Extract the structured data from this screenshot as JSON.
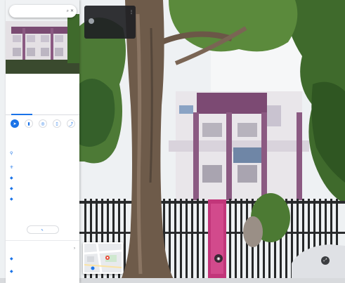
{
  "search": {
    "value": "",
    "placeholder": ""
  },
  "icons": {
    "search": "search-icon",
    "close": "close-icon",
    "directions": "directions-icon",
    "save": "bookmark-icon",
    "nearby": "nearby-icon",
    "send": "send-to-phone-icon",
    "share": "share-icon",
    "location_pin": "location-pin-icon",
    "plus_code": "plus-code-icon",
    "label": "label-icon",
    "chevron": "chevron-icon",
    "edit": "pencil-icon",
    "more": "more-vert-icon",
    "zoom": "zoom-icon",
    "expand": "expand-icon"
  },
  "place": {
    "title": "",
    "category": "",
    "meta": ""
  },
  "tabs": [
    {
      "label": "",
      "active": true
    },
    {
      "label": "",
      "active": false
    }
  ],
  "actions": [
    {
      "label": "",
      "icon": "directions-icon",
      "style": "primary"
    },
    {
      "label": "",
      "icon": "bookmark-icon",
      "style": "outline"
    },
    {
      "label": "",
      "icon": "nearby-icon",
      "style": "outline"
    },
    {
      "label": "",
      "icon": "send-to-phone-icon",
      "style": "outline"
    },
    {
      "label": "",
      "icon": "share-icon",
      "style": "outline"
    }
  ],
  "info": [
    {
      "icon": "location-pin-icon",
      "text": "",
      "text2": ""
    },
    {
      "icon": "plus-code-icon",
      "text": ""
    },
    {
      "icon": "label-icon",
      "text": ""
    },
    {
      "icon": "label-icon",
      "text": ""
    },
    {
      "icon": "label-icon",
      "text": ""
    }
  ],
  "suggest_edit": {
    "label": ""
  },
  "section": {
    "heading": ""
  },
  "bottom_items": [
    {
      "text": ""
    },
    {
      "text": ""
    }
  ],
  "top_card": {
    "title": "",
    "subtitle": ""
  },
  "colors": {
    "accent": "#1a73e8",
    "card_bg": "#202124",
    "building_wall": "#e9e6ea",
    "building_accent": "#7c4a73",
    "gate_pink": "#c2367a",
    "tree_trunk": "#6e5b4a",
    "foliage": "#3f6a2c",
    "sky": "#f2f4f6"
  }
}
